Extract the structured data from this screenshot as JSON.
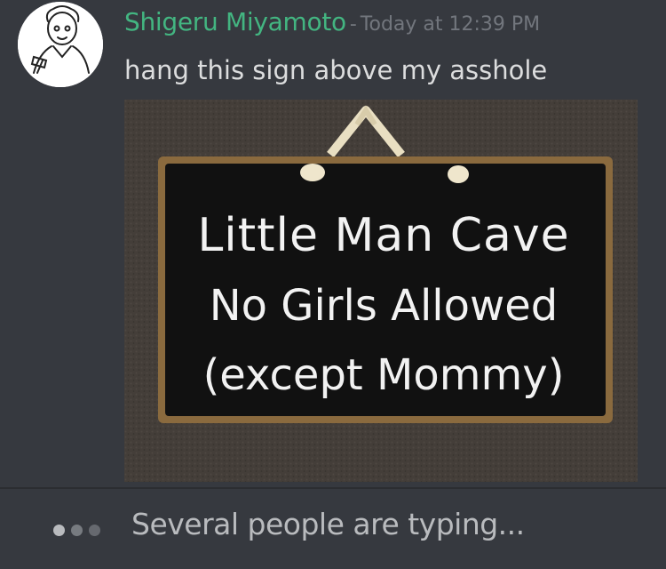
{
  "message": {
    "avatar_icon": "user-sketch-avatar",
    "username": "Shigeru Miyamoto",
    "separator": "-",
    "timestamp": "Today at 12:39 PM",
    "text": "hang this sign above my asshole",
    "attachment": {
      "sign_lines": [
        "Little Man Cave",
        "No Girls Allowed",
        "(except Mommy)"
      ]
    }
  },
  "typing": {
    "icon": "typing-dots-icon",
    "text": "Several people are typing..."
  },
  "colors": {
    "background": "#36393f",
    "username": "#43b581",
    "timestamp": "#72767d",
    "message_text": "#dcddde",
    "typing_text": "#b9bbbe"
  }
}
